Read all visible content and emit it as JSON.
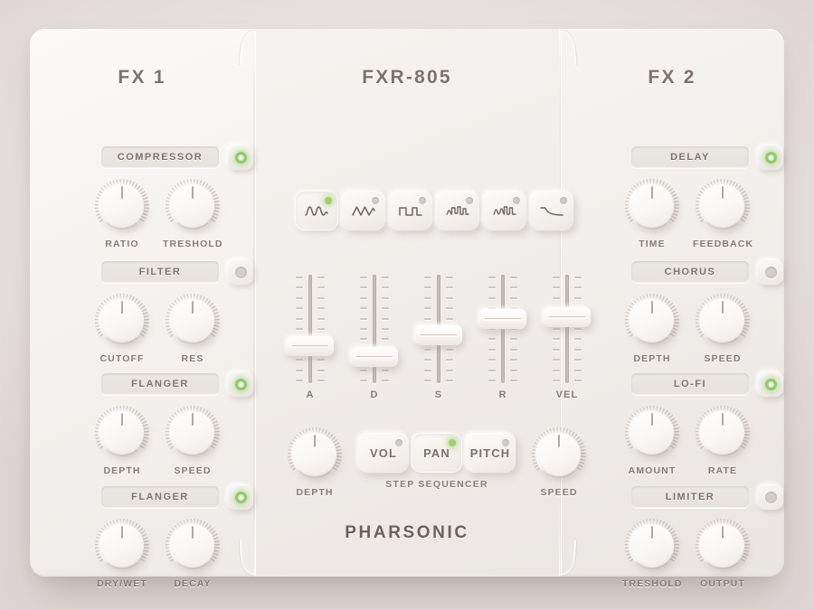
{
  "device": {
    "brand": "PHARSONIC",
    "model_title": "FXR-805",
    "left_title": "FX 1",
    "right_title": "FX 2",
    "colors": {
      "background": "#eae7e5",
      "panel": "#f4f1ee",
      "text": "#7d736c",
      "led_on": "#93c96c",
      "led_off": "#d2cbc6"
    }
  },
  "fx1": {
    "title": "FX 1",
    "sections": [
      {
        "name": "COMPRESSOR",
        "led": "on",
        "knobs": [
          {
            "label": "RATIO",
            "angle": 0
          },
          {
            "label": "TRESHOLD",
            "angle": 0
          }
        ]
      },
      {
        "name": "FILTER",
        "led": "off",
        "knobs": [
          {
            "label": "CUTOFF",
            "angle": 0
          },
          {
            "label": "RES",
            "angle": 0
          }
        ]
      },
      {
        "name": "FLANGER",
        "led": "on",
        "knobs": [
          {
            "label": "DEPTH",
            "angle": 0
          },
          {
            "label": "SPEED",
            "angle": 0
          }
        ]
      },
      {
        "name": "FLANGER",
        "led": "on",
        "knobs": [
          {
            "label": "DRY/WET",
            "angle": 0
          },
          {
            "label": "DECAY",
            "angle": 0
          }
        ]
      }
    ]
  },
  "fx2": {
    "title": "FX 2",
    "sections": [
      {
        "name": "DELAY",
        "led": "on",
        "knobs": [
          {
            "label": "TIME",
            "angle": 0
          },
          {
            "label": "FEEDBACK",
            "angle": 0
          }
        ]
      },
      {
        "name": "CHORUS",
        "led": "off",
        "knobs": [
          {
            "label": "DEPTH",
            "angle": 0
          },
          {
            "label": "SPEED",
            "angle": 0
          }
        ]
      },
      {
        "name": "LO-FI",
        "led": "on",
        "knobs": [
          {
            "label": "AMOUNT",
            "angle": 0
          },
          {
            "label": "RATE",
            "angle": 0
          }
        ]
      },
      {
        "name": "LIMITER",
        "led": "off",
        "knobs": [
          {
            "label": "TRESHOLD",
            "angle": 0
          },
          {
            "label": "OUTPUT",
            "angle": 0
          }
        ]
      }
    ]
  },
  "center": {
    "title": "FXR-805",
    "waveforms": [
      {
        "icon": "waveform-sine-icon",
        "led": "on"
      },
      {
        "icon": "waveform-triangle-icon",
        "led": "off"
      },
      {
        "icon": "waveform-square-icon",
        "led": "off"
      },
      {
        "icon": "waveform-stepped-icon",
        "led": "off"
      },
      {
        "icon": "waveform-noise-icon",
        "led": "off"
      },
      {
        "icon": "waveform-decay-icon",
        "led": "off"
      }
    ],
    "envelope": {
      "sliders": [
        {
          "label": "A",
          "value": 31
        },
        {
          "label": "D",
          "value": 18
        },
        {
          "label": "S",
          "value": 43
        },
        {
          "label": "R",
          "value": 61
        },
        {
          "label": "VEL",
          "value": 63
        }
      ]
    },
    "step_sequencer": {
      "caption": "STEP SEQUENCER",
      "buttons": [
        {
          "label": "VOL",
          "led": "off"
        },
        {
          "label": "PAN",
          "led": "on"
        },
        {
          "label": "PITCH",
          "led": "off"
        }
      ]
    },
    "depth_knob": {
      "label": "DEPTH",
      "angle": 0
    },
    "speed_knob": {
      "label": "SPEED",
      "angle": 0
    }
  }
}
